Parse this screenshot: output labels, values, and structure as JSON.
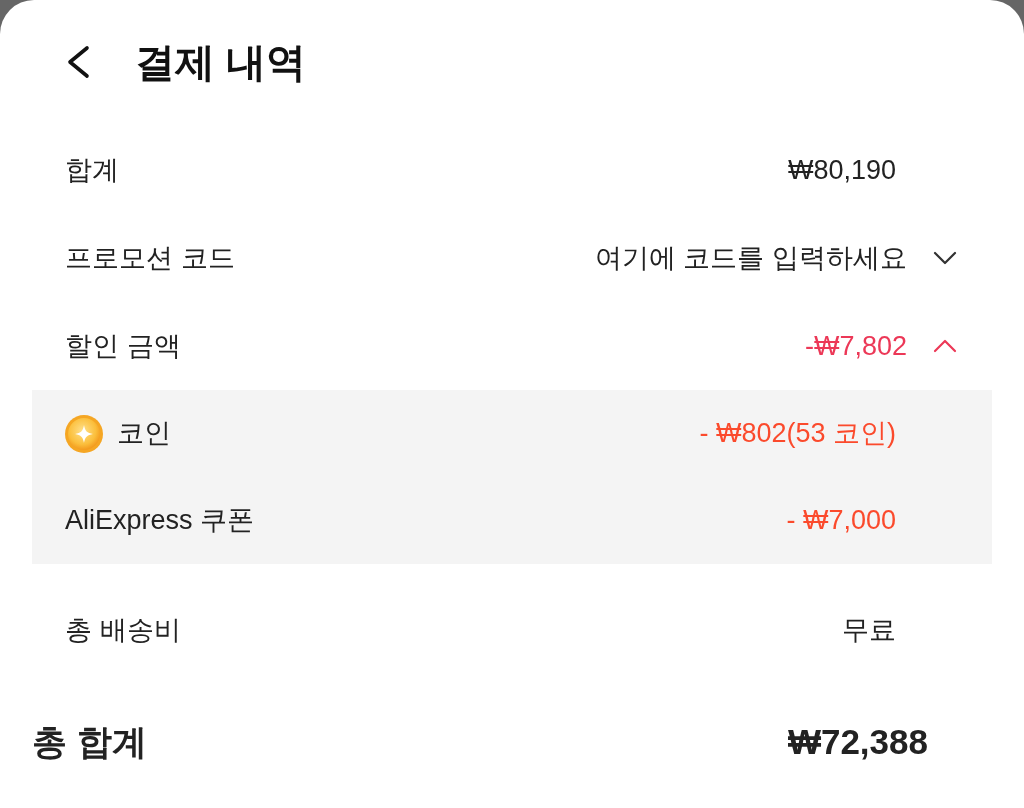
{
  "header": {
    "title": "결제 내역"
  },
  "rows": [
    {
      "kind": "amount",
      "label": "합계",
      "value": "₩80,190"
    },
    {
      "kind": "code",
      "label": "프로모션 코드",
      "value": "여기에 코드를 입력하세요",
      "expanded": false
    },
    {
      "kind": "discount",
      "label": "할인 금액",
      "value": "-₩7,802",
      "expanded": true,
      "details": [
        {
          "kind": "coin",
          "label": "코인",
          "value": "- ₩802(53 코인)"
        },
        {
          "kind": "coupon",
          "label": "AliExpress 쿠폰",
          "value": "- ₩7,000"
        }
      ]
    },
    {
      "kind": "amount",
      "label": "총 배송비",
      "value": "무료"
    }
  ],
  "total": {
    "label": "총 합계",
    "value": "₩72,388"
  }
}
